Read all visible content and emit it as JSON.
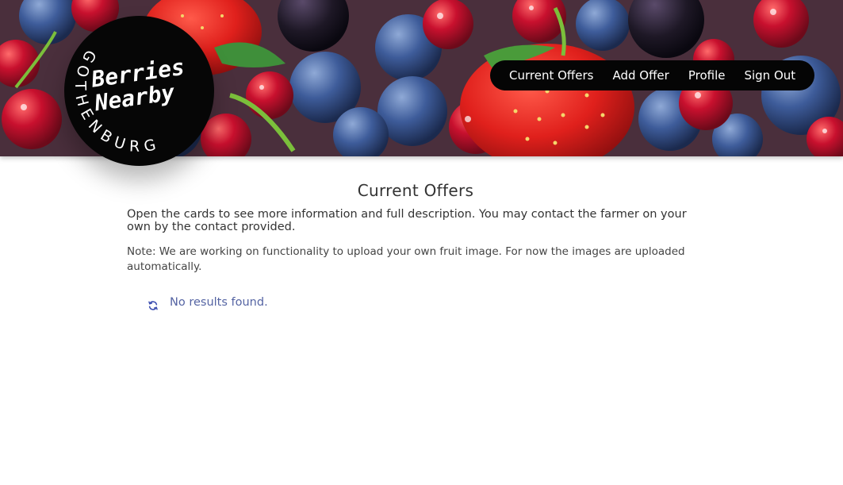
{
  "logo": {
    "line1": "Berries",
    "line2": "Nearby",
    "city": "GOTHENBURG"
  },
  "nav": {
    "items": [
      {
        "label": "Current Offers"
      },
      {
        "label": "Add Offer"
      },
      {
        "label": "Profile"
      },
      {
        "label": "Sign Out"
      }
    ]
  },
  "main": {
    "title": "Current Offers",
    "intro": "Open the cards to see more information and full description. You may contact the farmer on your own by the contact provided.",
    "note": "Note: We are working on functionality to upload your own fruit image. For now the images are uploaded automatically.",
    "empty_message": "No results found."
  },
  "icons": {
    "refresh": "refresh-icon"
  },
  "colors": {
    "nav_bg": "#050505",
    "logo_bg": "#060606",
    "empty_text": "#5564a3",
    "refresh_icon": "#3d4fb0"
  }
}
